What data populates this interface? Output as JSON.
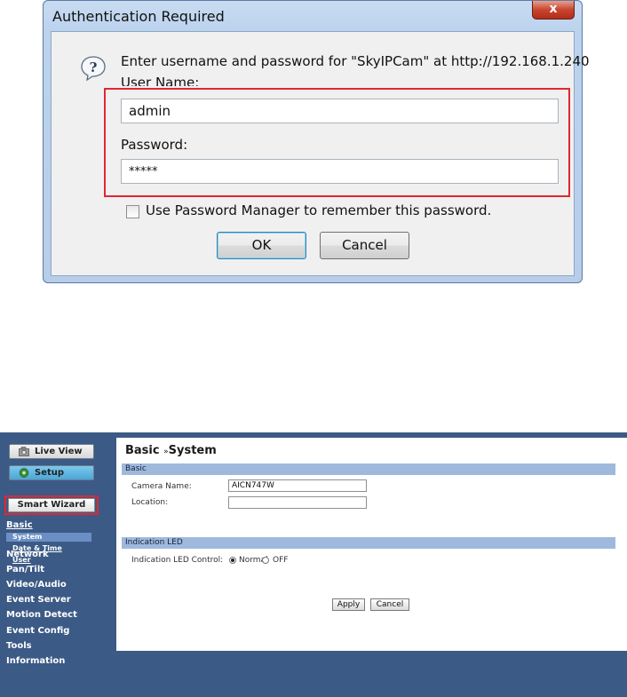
{
  "auth_dialog": {
    "title": "Authentication Required",
    "close_glyph": "x",
    "prompt": "Enter username and password for \"SkyIPCam\" at http://192.168.1.240",
    "username_label": "User Name:",
    "username_value": "admin",
    "password_label": "Password:",
    "password_value": "*****",
    "remember_label": "Use Password Manager to remember this password.",
    "remember_checked": false,
    "ok_label": "OK",
    "cancel_label": "Cancel",
    "icon": "question-icon",
    "highlight_color": "#e0272f"
  },
  "camera_ui": {
    "nav": {
      "live_view": "Live View",
      "setup": "Setup",
      "smart_wizard": "Smart Wizard",
      "basic": "Basic",
      "basic_items": [
        "System",
        "Date & Time",
        "User"
      ],
      "menu": [
        "Network",
        "Pan/Tilt",
        "Video/Audio",
        "Event Server",
        "Motion Detect",
        "Event Config",
        "Tools",
        "Information"
      ]
    },
    "page_title": "Basic",
    "page_title_sep": "»",
    "page_subtitle": "System",
    "section_basic": "Basic",
    "camera_name_label": "Camera Name:",
    "camera_name_value": "AICN747W",
    "location_label": "Location:",
    "location_value": "",
    "section_led": "Indication LED",
    "led_control_label": "Indication LED Control:",
    "led_options": [
      "Normal",
      "OFF"
    ],
    "led_selected": "Normal",
    "apply_label": "Apply",
    "cancel_label": "Cancel",
    "colors": {
      "nav_bg": "#3c5a86",
      "section_bar": "#9fb9dd",
      "selected_item": "#6b8fc4"
    }
  }
}
